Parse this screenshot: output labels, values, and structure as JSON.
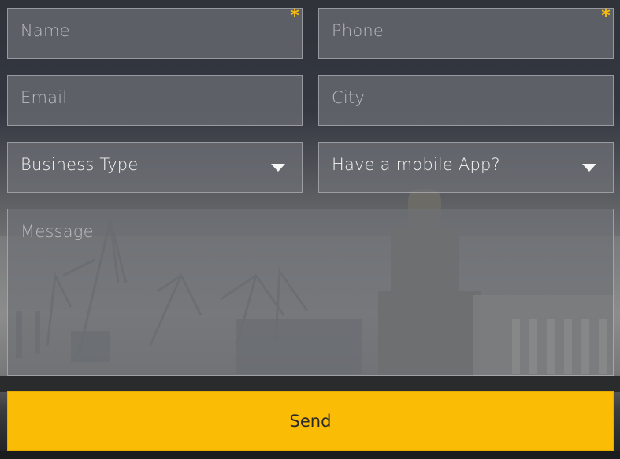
{
  "form": {
    "name_placeholder": "Name",
    "phone_placeholder": "Phone",
    "email_placeholder": "Email",
    "city_placeholder": "City",
    "business_type_selected": "Business Type",
    "mobile_app_selected": "Have a mobile App?",
    "message_placeholder": "Message",
    "required_mark": "*",
    "send_label": "Send"
  },
  "colors": {
    "accent": "#fbbc05",
    "required": "#f9bd0c"
  },
  "icons": {
    "dropdown": "triangle-down"
  }
}
